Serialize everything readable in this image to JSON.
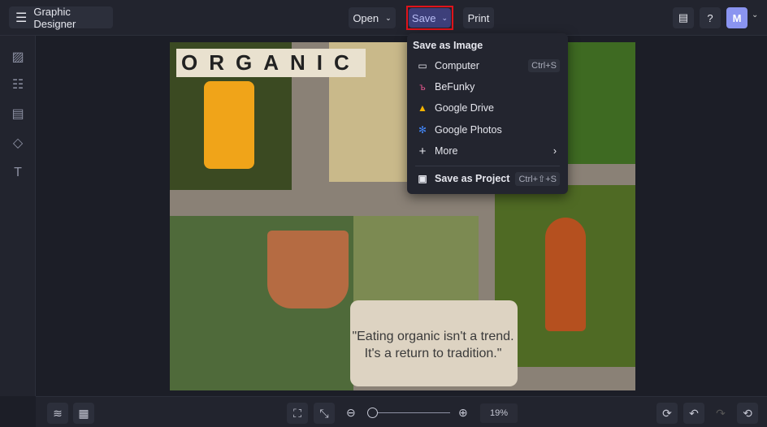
{
  "app": {
    "title": "Graphic Designer",
    "avatar_initial": "M"
  },
  "toolbar": {
    "open_label": "Open",
    "save_label": "Save",
    "print_label": "Print"
  },
  "save_menu": {
    "heading": "Save as Image",
    "items": [
      {
        "label": "Computer",
        "icon": "monitor-icon",
        "shortcut": "Ctrl+S"
      },
      {
        "label": "BeFunky",
        "icon": "befunky-icon"
      },
      {
        "label": "Google Drive",
        "icon": "google-drive-icon"
      },
      {
        "label": "Google Photos",
        "icon": "google-photos-icon"
      },
      {
        "label": "More",
        "icon": "plus-icon"
      }
    ],
    "project": {
      "label": "Save as Project",
      "shortcut": "Ctrl+⇧+S",
      "icon": "briefcase-icon"
    }
  },
  "canvas": {
    "title_text": "ORGANIC",
    "quote": "\"Eating organic isn't a trend. It's a return to tradition.\""
  },
  "zoom": {
    "value": "19%",
    "level_percent": 19
  },
  "colors": {
    "accent": "#3d3f7a",
    "highlight": "#e0131b",
    "avatar": "#8a94f0"
  }
}
